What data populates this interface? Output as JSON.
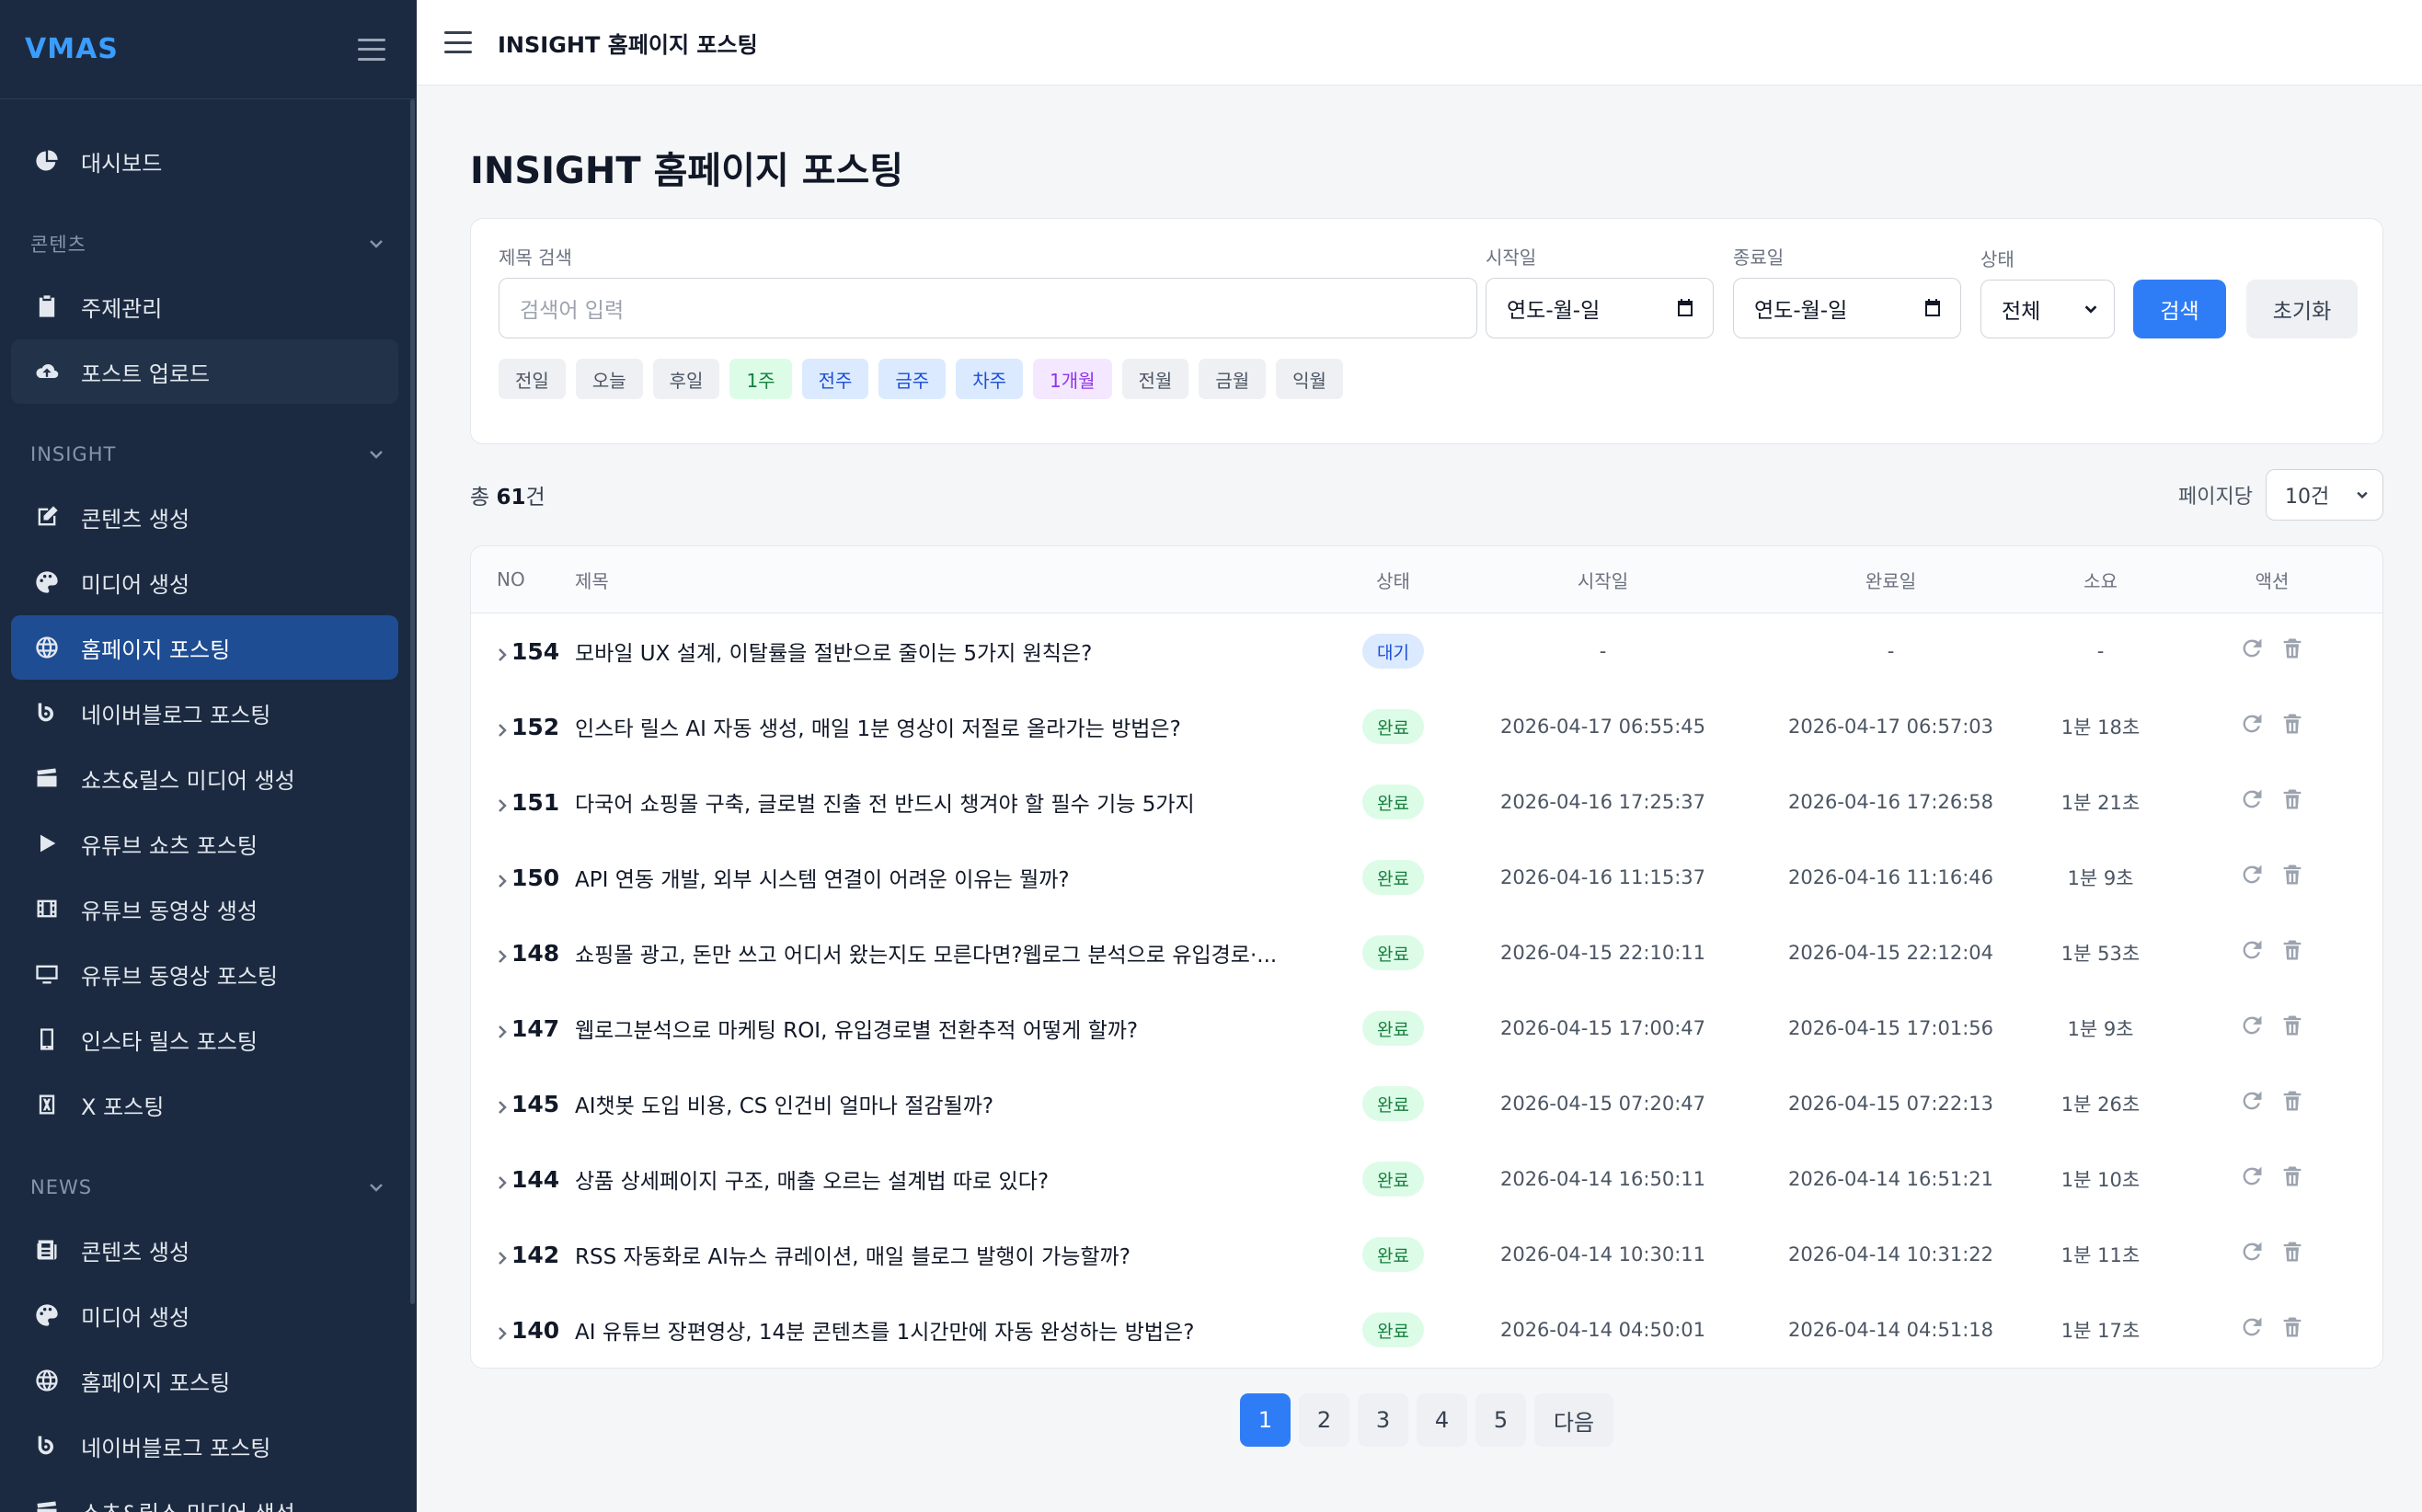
{
  "sidebar": {
    "logo": "VMAS",
    "items_top": [
      {
        "label": "대시보드",
        "icon": "pie-chart-icon"
      }
    ],
    "sections": [
      {
        "title": "콘텐츠",
        "items": [
          {
            "label": "주제관리",
            "icon": "clipboard-icon"
          },
          {
            "label": "포스트 업로드",
            "icon": "cloud-upload-icon"
          }
        ]
      },
      {
        "title": "INSIGHT",
        "items": [
          {
            "label": "콘텐츠 생성",
            "icon": "edit-icon"
          },
          {
            "label": "미디어 생성",
            "icon": "palette-icon"
          },
          {
            "label": "홈페이지 포스팅",
            "icon": "globe-icon"
          },
          {
            "label": "네이버블로그 포스팅",
            "icon": "blog-icon"
          },
          {
            "label": "쇼츠&릴스 미디어 생성",
            "icon": "clapper-icon"
          },
          {
            "label": "유튜브 쇼츠 포스팅",
            "icon": "play-icon"
          },
          {
            "label": "유튜브 동영상 생성",
            "icon": "film-icon"
          },
          {
            "label": "유튜브 동영상 포스팅",
            "icon": "monitor-icon"
          },
          {
            "label": "인스타 릴스 포스팅",
            "icon": "phone-icon"
          },
          {
            "label": "X 포스팅",
            "icon": "x-icon"
          }
        ]
      },
      {
        "title": "NEWS",
        "items": [
          {
            "label": "콘텐츠 생성",
            "icon": "newspaper-icon"
          },
          {
            "label": "미디어 생성",
            "icon": "palette-icon"
          },
          {
            "label": "홈페이지 포스팅",
            "icon": "globe-icon"
          },
          {
            "label": "네이버블로그 포스팅",
            "icon": "blog-icon"
          },
          {
            "label": "쇼츠&릴스 미디어 생성",
            "icon": "clapper-icon"
          }
        ]
      }
    ]
  },
  "topbar": {
    "title": "INSIGHT 홈페이지 포스팅"
  },
  "page": {
    "title": "INSIGHT 홈페이지 포스팅"
  },
  "filters": {
    "title_label": "제목 검색",
    "title_placeholder": "검색어 입력",
    "start_label": "시작일",
    "start_value": "연도-월-일",
    "end_label": "종료일",
    "end_value": "연도-월-일",
    "status_label": "상태",
    "status_value": "전체",
    "search_button": "검색",
    "reset_button": "초기화",
    "chips": [
      "전일",
      "오늘",
      "후일",
      "1주",
      "전주",
      "금주",
      "차주",
      "1개월",
      "전월",
      "금월",
      "익월"
    ]
  },
  "summary": {
    "prefix": "총 ",
    "count": "61",
    "suffix": "건",
    "perpage_label": "페이지당",
    "perpage_value": "10건"
  },
  "table": {
    "headers": {
      "no": "NO",
      "title": "제목",
      "status": "상태",
      "start": "시작일",
      "end": "완료일",
      "duration": "소요",
      "actions": "액션"
    },
    "rows": [
      {
        "no": "154",
        "title": "모바일 UX 설계, 이탈률을 절반으로 줄이는 5가지 원칙은?",
        "status": "대기",
        "start": "-",
        "end": "-",
        "duration": "-"
      },
      {
        "no": "152",
        "title": "인스타 릴스 AI 자동 생성, 매일 1분 영상이 저절로 올라가는 방법은?",
        "status": "완료",
        "start": "2026-04-17 06:55:45",
        "end": "2026-04-17 06:57:03",
        "duration": "1분 18초"
      },
      {
        "no": "151",
        "title": "다국어 쇼핑몰 구축, 글로벌 진출 전 반드시 챙겨야 할 필수 기능 5가지",
        "status": "완료",
        "start": "2026-04-16 17:25:37",
        "end": "2026-04-16 17:26:58",
        "duration": "1분 21초"
      },
      {
        "no": "150",
        "title": "API 연동 개발, 외부 시스템 연결이 어려운 이유는 뭘까?",
        "status": "완료",
        "start": "2026-04-16 11:15:37",
        "end": "2026-04-16 11:16:46",
        "duration": "1분 9초"
      },
      {
        "no": "148",
        "title": "쇼핑몰 광고, 돈만 쓰고 어디서 왔는지도 모른다면?웹로그 분석으로 유입경로·...",
        "status": "완료",
        "start": "2026-04-15 22:10:11",
        "end": "2026-04-15 22:12:04",
        "duration": "1분 53초"
      },
      {
        "no": "147",
        "title": "웹로그분석으로 마케팅 ROI, 유입경로별 전환추적 어떻게 할까?",
        "status": "완료",
        "start": "2026-04-15 17:00:47",
        "end": "2026-04-15 17:01:56",
        "duration": "1분 9초"
      },
      {
        "no": "145",
        "title": "AI챗봇 도입 비용, CS 인건비 얼마나 절감될까?",
        "status": "완료",
        "start": "2026-04-15 07:20:47",
        "end": "2026-04-15 07:22:13",
        "duration": "1분 26초"
      },
      {
        "no": "144",
        "title": "상품 상세페이지 구조, 매출 오르는 설계법 따로 있다?",
        "status": "완료",
        "start": "2026-04-14 16:50:11",
        "end": "2026-04-14 16:51:21",
        "duration": "1분 10초"
      },
      {
        "no": "142",
        "title": "RSS 자동화로 AI뉴스 큐레이션, 매일 블로그 발행이 가능할까?",
        "status": "완료",
        "start": "2026-04-14 10:30:11",
        "end": "2026-04-14 10:31:22",
        "duration": "1분 11초"
      },
      {
        "no": "140",
        "title": "AI 유튜브 장편영상, 14분 콘텐츠를 1시간만에 자동 완성하는 방법은?",
        "status": "완료",
        "start": "2026-04-14 04:50:01",
        "end": "2026-04-14 04:51:18",
        "duration": "1분 17초"
      }
    ]
  },
  "pagination": {
    "pages": [
      "1",
      "2",
      "3",
      "4",
      "5"
    ],
    "active": "1",
    "next": "다음"
  },
  "colors": {
    "accent": "#2f7df6",
    "sidebar_bg": "#1b2a40",
    "sidebar_active": "#1f4d93",
    "logo": "#3b9cff",
    "done": "#15803d",
    "wait": "#1d4ed8"
  }
}
